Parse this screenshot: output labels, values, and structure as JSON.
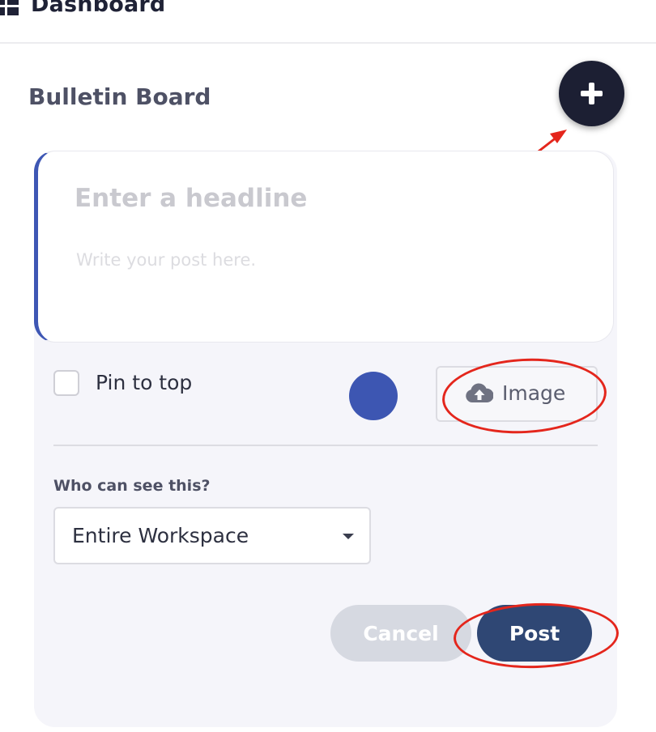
{
  "header": {
    "title": "Dashboard",
    "icon": "dashboard-grid-icon"
  },
  "bulletin": {
    "title": "Bulletin Board",
    "add_icon": "plus-icon",
    "editor": {
      "headline_placeholder": "Enter a headline",
      "body_placeholder": "Write your post here."
    },
    "pin_label": "Pin to top",
    "pin_checked": false,
    "color": "#3d56b2",
    "image_button": {
      "label": "Image",
      "icon": "cloud-upload-icon"
    },
    "visibility": {
      "label": "Who can see this?",
      "selected": "Entire Workspace"
    },
    "actions": {
      "cancel": "Cancel",
      "post": "Post"
    }
  },
  "annotations": {
    "color": "#e4261c"
  }
}
